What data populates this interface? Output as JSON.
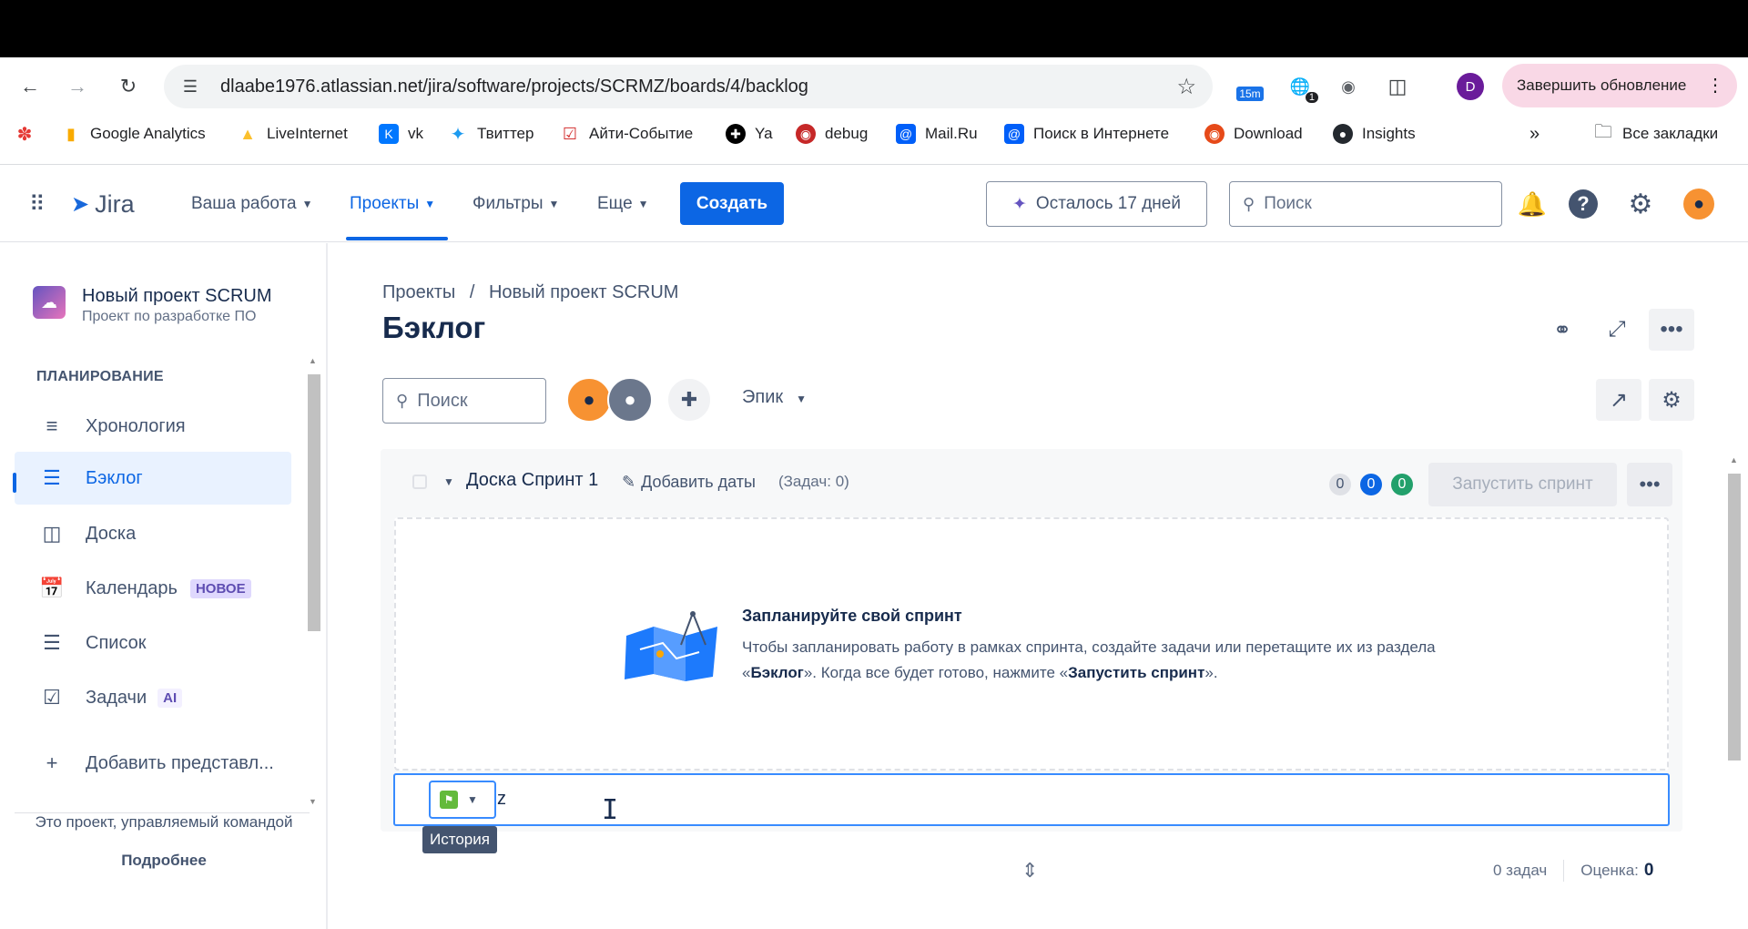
{
  "browser": {
    "url": "dlaabe1976.atlassian.net/jira/software/projects/SCRMZ/boards/4/backlog",
    "ext_badge_1": "15m",
    "ext_badge_2": "1",
    "profile_letter": "D",
    "finish_update": "Завершить обновление",
    "bookmarks": [
      {
        "label": "Google Analytics",
        "icon": "analytics-icon"
      },
      {
        "label": "LiveInternet",
        "icon": "liveinternet-icon"
      },
      {
        "label": "vk",
        "icon": "vk-icon"
      },
      {
        "label": "Твиттер",
        "icon": "twitter-icon"
      },
      {
        "label": "Айти-Событие",
        "icon": "calendar-icon"
      },
      {
        "label": "Ya",
        "icon": "ya-icon"
      },
      {
        "label": "debug",
        "icon": "debug-icon"
      },
      {
        "label": "Mail.Ru",
        "icon": "mail-icon"
      },
      {
        "label": "Поиск в Интернете",
        "icon": "mail-icon"
      },
      {
        "label": "Download",
        "icon": "download-icon"
      },
      {
        "label": "Insights",
        "icon": "github-icon"
      }
    ],
    "all_bookmarks": "Все закладки"
  },
  "jira_nav": {
    "logo": "Jira",
    "items": [
      "Ваша работа",
      "Проекты",
      "Фильтры",
      "Еще"
    ],
    "create": "Создать",
    "trial": "Осталось 17 дней",
    "search_placeholder": "Поиск"
  },
  "sidebar": {
    "project_name": "Новый проект SCRUM",
    "project_sub": "Проект по разработке ПО",
    "section": "ПЛАНИРОВАНИЕ",
    "items": [
      {
        "label": "Хронология"
      },
      {
        "label": "Бэклог"
      },
      {
        "label": "Доска"
      },
      {
        "label": "Календарь",
        "badge": "НОВОЕ"
      },
      {
        "label": "Список"
      },
      {
        "label": "Задачи",
        "badge": "AI"
      },
      {
        "label": "Добавить представл..."
      }
    ],
    "footer_text": "Это проект, управляемый командой",
    "footer_more": "Подробнее"
  },
  "main": {
    "breadcrumb_1": "Проекты",
    "breadcrumb_sep": "/",
    "breadcrumb_2": "Новый проект SCRUM",
    "title": "Бэклог",
    "search_placeholder": "Поиск",
    "epic": "Эпик",
    "sprint": {
      "name": "Доска Спринт 1",
      "add_dates": "Добавить даты",
      "count": "(Задач: 0)",
      "pills": [
        "0",
        "0",
        "0"
      ],
      "start": "Запустить спринт",
      "empty_title": "Запланируйте свой спринт",
      "empty_desc_1": "Чтобы запланировать работу в рамках спринта, создайте задачи или перетащите их из раздела «",
      "empty_desc_bold_1": "Бэклог",
      "empty_desc_2": "». Когда все будет готово, нажмите «",
      "empty_desc_bold_2": "Запустить спринт",
      "empty_desc_3": "».",
      "input_value": "z",
      "tooltip": "История"
    },
    "footer_tasks": "0 задач",
    "footer_estimate_label": "Оценка:",
    "footer_estimate_value": "0"
  }
}
